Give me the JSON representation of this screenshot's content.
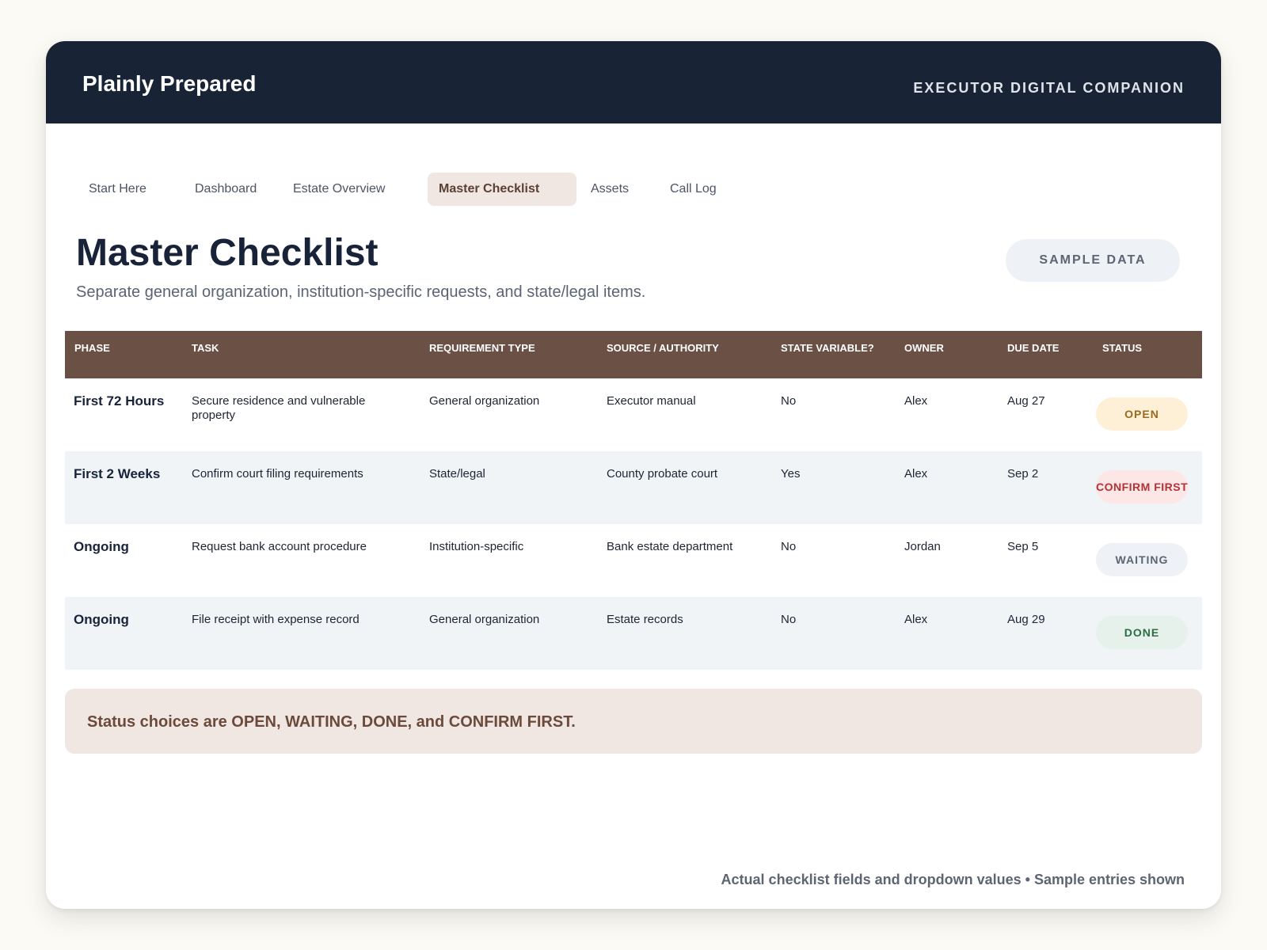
{
  "header": {
    "brand": "Plainly Prepared",
    "companion": "EXECUTOR DIGITAL COMPANION"
  },
  "nav": {
    "tabs": [
      {
        "label": "Start Here",
        "active": false
      },
      {
        "label": "Dashboard",
        "active": false
      },
      {
        "label": "Estate Overview",
        "active": false
      },
      {
        "label": "Master Checklist",
        "active": true
      },
      {
        "label": "Assets",
        "active": false
      },
      {
        "label": "Call Log",
        "active": false
      }
    ]
  },
  "page": {
    "title": "Master Checklist",
    "subtitle": "Separate general organization, institution-specific requests, and state/legal items.",
    "badge": "SAMPLE DATA"
  },
  "table": {
    "columns": [
      "PHASE",
      "TASK",
      "REQUIREMENT TYPE",
      "SOURCE / AUTHORITY",
      "STATE VARIABLE?",
      "OWNER",
      "DUE DATE",
      "STATUS"
    ],
    "rows": [
      {
        "phase": "First 72 Hours",
        "task": "Secure residence and vulnerable property",
        "requirement": "General organization",
        "source": "Executor manual",
        "state_variable": "No",
        "owner": "Alex",
        "due": "Aug 27",
        "status": "OPEN"
      },
      {
        "phase": "First 2 Weeks",
        "task": "Confirm court filing requirements",
        "requirement": "State/legal",
        "source": "County probate court",
        "state_variable": "Yes",
        "owner": "Alex",
        "due": "Sep 2",
        "status": "CONFIRM FIRST"
      },
      {
        "phase": "Ongoing",
        "task": "Request bank account procedure",
        "requirement": "Institution-specific",
        "source": "Bank estate department",
        "state_variable": "No",
        "owner": "Jordan",
        "due": "Sep 5",
        "status": "WAITING"
      },
      {
        "phase": "Ongoing",
        "task": "File receipt with expense record",
        "requirement": "General organization",
        "source": "Estate records",
        "state_variable": "No",
        "owner": "Alex",
        "due": "Aug 29",
        "status": "DONE"
      }
    ]
  },
  "status_colors": {
    "OPEN": "#9a6a22",
    "CONFIRM FIRST": "#b23236",
    "WAITING": "#5d6573",
    "DONE": "#2d6d45"
  },
  "note": "Status choices are OPEN, WAITING, DONE, and CONFIRM FIRST.",
  "footer": "Actual checklist fields and dropdown values • Sample entries shown"
}
